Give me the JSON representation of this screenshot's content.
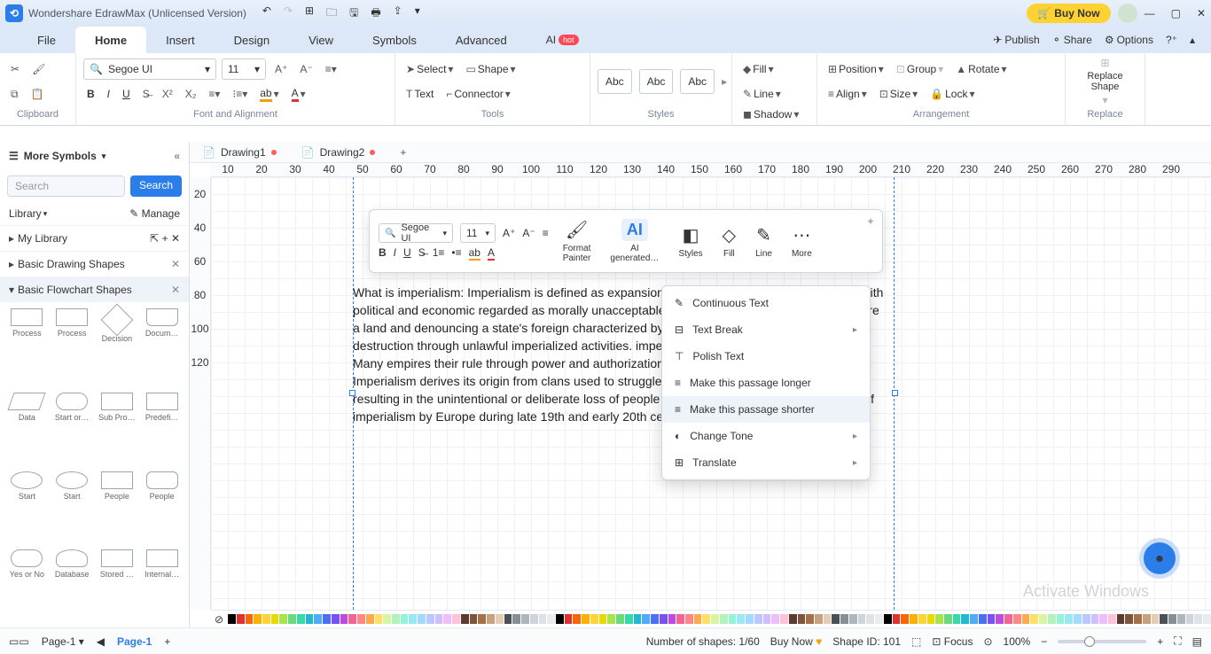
{
  "app": {
    "title": "Wondershare EdrawMax (Unlicensed Version)",
    "buy": "Buy Now"
  },
  "menu": {
    "file": "File",
    "home": "Home",
    "insert": "Insert",
    "design": "Design",
    "view": "View",
    "symbols": "Symbols",
    "advanced": "Advanced",
    "ai": "AI",
    "hot": "hot",
    "publish": "Publish",
    "share": "Share",
    "options": "Options"
  },
  "ribbon": {
    "clipboard": "Clipboard",
    "fontalign": "Font and Alignment",
    "tools": "Tools",
    "styles": "Styles",
    "arrangement": "Arrangement",
    "replace_group": "Replace",
    "font": "Segoe UI",
    "size": "11",
    "select": "Select",
    "shape": "Shape",
    "text": "Text",
    "connector": "Connector",
    "abc": "Abc",
    "fill": "Fill",
    "line": "Line",
    "shadow": "Shadow",
    "position": "Position",
    "align": "Align",
    "group": "Group",
    "size_btn": "Size",
    "rotate": "Rotate",
    "lock": "Lock",
    "replace": "Replace\nShape"
  },
  "left": {
    "more": "More Symbols",
    "search_ph": "Search",
    "search_btn": "Search",
    "library": "Library",
    "manage": "Manage",
    "mylib": "My Library",
    "basic_draw": "Basic Drawing Shapes",
    "basic_flow": "Basic Flowchart Shapes",
    "shapes": [
      "Process",
      "Process",
      "Decision",
      "Docum…",
      "Data",
      "Start or…",
      "Sub Pro…",
      "Predefi…",
      "Start",
      "Start",
      "People",
      "People",
      "Yes or No",
      "Database",
      "Stored …",
      "Internal…"
    ]
  },
  "tabs": {
    "d1": "Drawing1",
    "d2": "Drawing2"
  },
  "ruler_h": [
    "10",
    "20",
    "30",
    "40",
    "50",
    "60",
    "70",
    "80",
    "90",
    "100",
    "110",
    "120",
    "130",
    "140",
    "150",
    "160",
    "170",
    "180",
    "190",
    "200",
    "210",
    "220",
    "230",
    "240",
    "250",
    "260",
    "270",
    "280",
    "290"
  ],
  "ruler_v": [
    "20",
    "40",
    "60",
    "80",
    "100",
    "120"
  ],
  "body_text": "What is imperialism: Imperialism is defined as expansion of the implementation of rule along with political and economic regarded as morally unacceptable. Imposition of rule by forces to capture a land and denouncing a state's foreign characterized by subjugation of the rights of many and destruction through unlawful imperialized activities. imperialism is as old as human civilization. Many empires their rule through power and authorization. Strong states unable to retaliate. Imperialism derives its origin from clans used to struggle for scarce food and resources. far, resulting in the unintentional or deliberate loss of people as well. The most common instance of imperialism by Europe during late 19th and early 20th century.",
  "mini": {
    "font": "Segoe UI",
    "size": "11",
    "format": "Format\nPainter",
    "ai": "AI\ngenerated…",
    "styles": "Styles",
    "fill": "Fill",
    "line": "Line",
    "more": "More",
    "ai_icon": "AI"
  },
  "ctx": {
    "continuous": "Continuous Text",
    "break": "Text Break",
    "polish": "Polish Text",
    "longer": "Make this passage longer",
    "shorter": "Make this passage shorter",
    "tone": "Change Tone",
    "translate": "Translate"
  },
  "status": {
    "page": "Page-1",
    "page_active": "Page-1",
    "shapes_lbl": "Number of shapes:",
    "shapes_val": "1/60",
    "buy": "Buy Now",
    "shapeid_lbl": "Shape ID:",
    "shapeid_val": "101",
    "focus": "Focus",
    "zoom": "100%"
  },
  "watermark": "Activate Windows",
  "palette": [
    "#000000",
    "#e03131",
    "#f76707",
    "#fab005",
    "#ffd43b",
    "#e8d90a",
    "#a9e34b",
    "#69db7c",
    "#38d9a9",
    "#22b8cf",
    "#4dabf7",
    "#4c6ef5",
    "#7950f2",
    "#be4bdb",
    "#f06595",
    "#ff8787",
    "#ffa94d",
    "#ffe066",
    "#d8f5a2",
    "#b2f2bb",
    "#96f2d7",
    "#99e9f2",
    "#a5d8ff",
    "#bac8ff",
    "#d0bfff",
    "#eebefa",
    "#fcc2d7",
    "#5c3b2e",
    "#7f5539",
    "#a47148",
    "#c6a27e",
    "#e6ccb2",
    "#495057",
    "#868e96",
    "#adb5bd",
    "#ced4da",
    "#dee2e6",
    "#e9ecef"
  ]
}
